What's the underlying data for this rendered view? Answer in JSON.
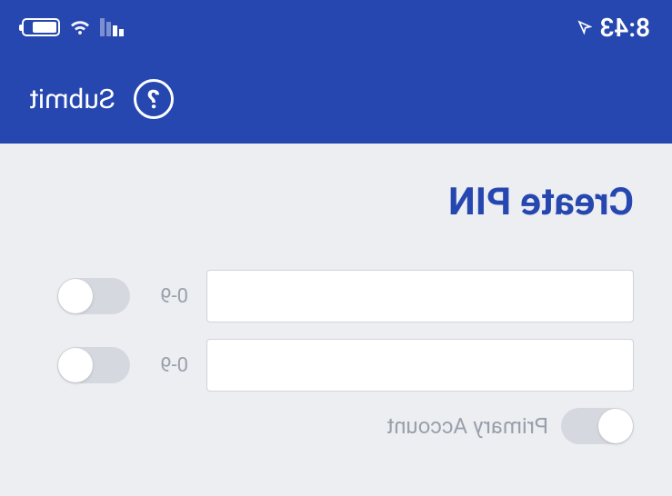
{
  "status": {
    "time": "8:43"
  },
  "appbar": {
    "submit_label": "Submit"
  },
  "page": {
    "title": "Create PIN"
  },
  "form": {
    "pin_hint": "0-9",
    "confirm_hint": "0-9",
    "primary_label": "Primary Account"
  }
}
